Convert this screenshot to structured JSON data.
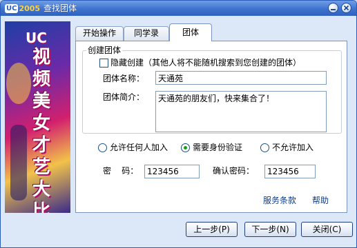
{
  "titlebar": {
    "logo_uc": "UC",
    "logo_year": "2005",
    "title": "查找团体"
  },
  "banner": {
    "brand": "UC",
    "slogan": "视频美女才艺大比拼"
  },
  "tabs": [
    {
      "label": "开始操作"
    },
    {
      "label": "同学录"
    },
    {
      "label": "团体"
    }
  ],
  "form": {
    "group_title": "创建团体",
    "hide_create_label": "隐藏创建（其他人将不能随机搜索到您创建的团体）",
    "hide_create_checked": false,
    "name_label": "团体名称：",
    "name_value": "天通苑",
    "intro_label": "团体简介：",
    "intro_value": "天通苑的朋友们，快来集合了！",
    "join_options": [
      {
        "label": "允许任何人加入",
        "selected": false
      },
      {
        "label": "需要身份验证",
        "selected": true
      },
      {
        "label": "不允许加入",
        "selected": false
      }
    ],
    "password_label": "密    码：",
    "password_value": "123456",
    "confirm_label": "确认密码：",
    "confirm_value": "123456"
  },
  "links": {
    "terms": "服务条款",
    "help": "帮助"
  },
  "buttons": {
    "prev": "上一步(P)",
    "next": "下一步(N)",
    "close": "关闭(C)"
  },
  "colors": {
    "titlebar": "#3e73cf",
    "window_bg": "#dce8f8",
    "radio_selected": "#1b9a1b"
  }
}
